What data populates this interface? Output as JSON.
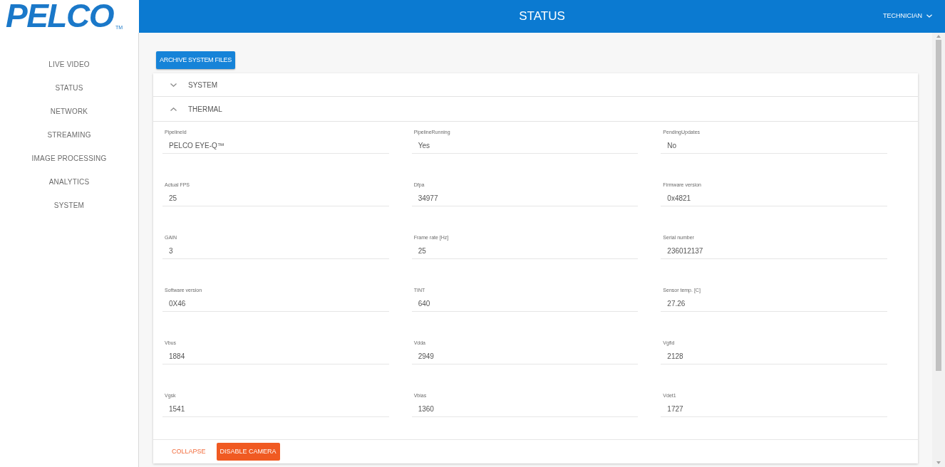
{
  "header": {
    "logo": "PELCO",
    "logo_tm": "TM",
    "title": "STATUS",
    "user_menu": "TECHNICIAN"
  },
  "sidebar": {
    "items": [
      "LIVE VIDEO",
      "STATUS",
      "NETWORK",
      "STREAMING",
      "IMAGE PROCESSING",
      "ANALYTICS",
      "SYSTEM"
    ]
  },
  "toolbar": {
    "archive_button": "ARCHIVE SYSTEM FILES"
  },
  "sections": [
    {
      "title": "SYSTEM",
      "expanded": false
    },
    {
      "title": "THERMAL",
      "expanded": true,
      "fields": [
        {
          "label": "PipelineId",
          "value": "PELCO EYE-Q™"
        },
        {
          "label": "PipelineRunning",
          "value": "Yes"
        },
        {
          "label": "PendingUpdates",
          "value": "No"
        },
        {
          "label": "Actual FPS",
          "value": "25"
        },
        {
          "label": "Dfpa",
          "value": "34977"
        },
        {
          "label": "Firmware version",
          "value": "0x4821"
        },
        {
          "label": "GAIN",
          "value": "3"
        },
        {
          "label": "Frame rate [Hz]",
          "value": "25"
        },
        {
          "label": "Serial number",
          "value": "236012137"
        },
        {
          "label": "Software version",
          "value": "0X46"
        },
        {
          "label": "TINT",
          "value": "640"
        },
        {
          "label": "Sensor temp. [C]",
          "value": "27.26"
        },
        {
          "label": "Vbus",
          "value": "1884"
        },
        {
          "label": "Vdda",
          "value": "2949"
        },
        {
          "label": "Vgfid",
          "value": "2128"
        },
        {
          "label": "Vgsk",
          "value": "1541"
        },
        {
          "label": "Vbias",
          "value": "1360"
        },
        {
          "label": "Vdet1",
          "value": "1727"
        }
      ],
      "actions": [
        {
          "label": "COLLAPSE",
          "kind": "text"
        },
        {
          "label": "DISABLE CAMERA",
          "kind": "filled"
        }
      ]
    }
  ]
}
